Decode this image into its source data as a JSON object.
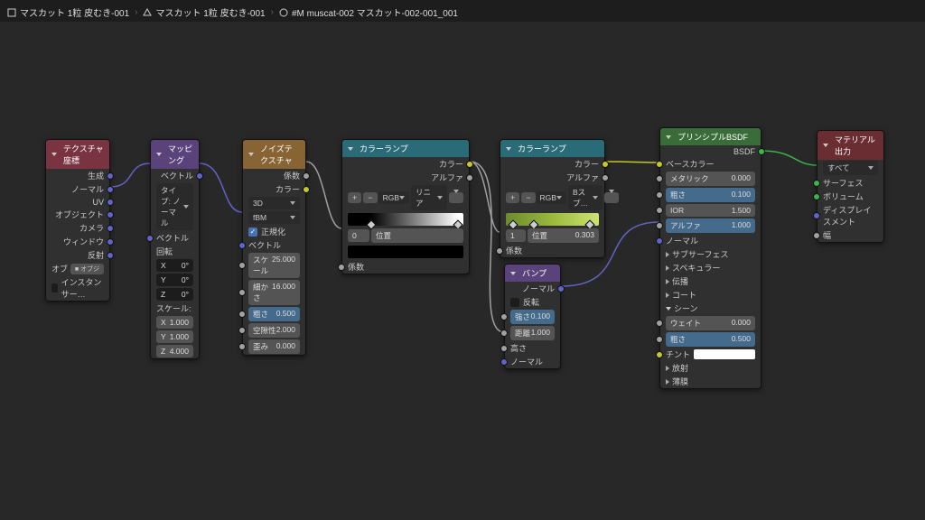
{
  "breadcrumb": {
    "part1": "マスカット 1粒 皮むき-001",
    "part2": "マスカット 1粒 皮むき-001",
    "part3": "#M muscat-002 マスカット-002-001_001"
  },
  "nodes": {
    "texcoord": {
      "title": "テクスチャ座標",
      "outputs": [
        "生成",
        "ノーマル",
        "UV",
        "オブジェクト",
        "カメラ",
        "ウィンドウ",
        "反射"
      ],
      "obj_label": "オブ",
      "obj_btn": "オブジ",
      "inst": "インスタンサー…"
    },
    "mapping": {
      "title": "マッピング",
      "out": "ベクトル",
      "type_lbl": "タイプ:",
      "type_val": "ノーマル",
      "vec": "ベクトル",
      "rot": "回転",
      "scale": "スケール:",
      "x": "X",
      "y": "Y",
      "z": "Z",
      "rx": "0°",
      "ry": "0°",
      "rz": "0°",
      "sx": "1.000",
      "sy": "1.000",
      "sz": "4.000"
    },
    "noise": {
      "title": "ノイズテクスチャ",
      "out_fac": "係数",
      "out_color": "カラー",
      "dim": "3D",
      "type": "fBM",
      "norm": "正規化",
      "vec": "ベクトル",
      "scale_lbl": "スケール",
      "scale_v": "25.000",
      "detail_lbl": "細かさ",
      "detail_v": "16.000",
      "rough_lbl": "粗さ",
      "rough_v": "0.500",
      "lac_lbl": "空隙性",
      "lac_v": "2.000",
      "dist_lbl": "歪み",
      "dist_v": "0.000"
    },
    "ramp1": {
      "title": "カラーランプ",
      "out_color": "カラー",
      "out_alpha": "アルファ",
      "mode1": "RGB",
      "mode2": "リニア",
      "pos_lbl": "位置",
      "pos_idx": "0",
      "pos_v": "",
      "fac": "係数"
    },
    "ramp2": {
      "title": "カラーランプ",
      "out_color": "カラー",
      "out_alpha": "アルファ",
      "mode1": "RGB",
      "mode2": "Bスプ…",
      "pos_idx": "1",
      "pos_lbl": "位置",
      "pos_v": "0.303",
      "fac": "係数"
    },
    "bump": {
      "title": "バンプ",
      "out": "ノーマル",
      "inv": "反転",
      "str_lbl": "強さ",
      "str_v": "0.100",
      "dist_lbl": "距離",
      "dist_v": "1.000",
      "h": "高さ",
      "n": "ノーマル"
    },
    "bsdf": {
      "title": "プリンシプルBSDF",
      "out": "BSDF",
      "base": "ベースカラー",
      "metal_lbl": "メタリック",
      "metal_v": "0.000",
      "rough_lbl": "粗さ",
      "rough_v": "0.100",
      "ior_lbl": "IOR",
      "ior_v": "1.500",
      "alpha_lbl": "アルファ",
      "alpha_v": "1.000",
      "normal": "ノーマル",
      "subs": "サブサーフェス",
      "spec": "スペキュラー",
      "trans": "伝播",
      "coat": "コート",
      "sheen": "シーン",
      "weight_lbl": "ウェイト",
      "weight_v": "0.000",
      "srough_lbl": "粗さ",
      "srough_v": "0.500",
      "tint": "チント",
      "emit": "放射",
      "thin": "薄膜"
    },
    "output": {
      "title": "マテリアル出力",
      "target": "すべて",
      "surf": "サーフェス",
      "vol": "ボリューム",
      "disp": "ディスプレイスメント",
      "th": "幅"
    }
  }
}
